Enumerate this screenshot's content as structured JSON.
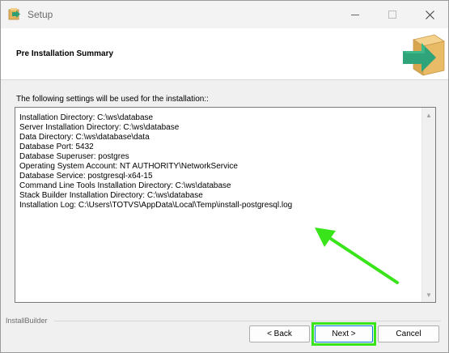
{
  "window": {
    "title": "Setup"
  },
  "header": {
    "title": "Pre Installation Summary"
  },
  "content": {
    "intro": "The following settings will be used for the installation::",
    "lines": [
      "Installation Directory: C:\\ws\\database",
      "Server Installation Directory: C:\\ws\\database",
      "Data Directory: C:\\ws\\database\\data",
      "Database Port: 5432",
      "Database Superuser: postgres",
      "Operating System Account: NT AUTHORITY\\NetworkService",
      "Database Service: postgresql-x64-15",
      "Command Line Tools Installation Directory: C:\\ws\\database",
      "Stack Builder Installation Directory: C:\\ws\\database",
      "Installation Log: C:\\Users\\TOTVS\\AppData\\Local\\Temp\\install-postgresql.log"
    ]
  },
  "footer": {
    "brand": "InstallBuilder",
    "back_label": "< Back",
    "next_label": "Next >",
    "cancel_label": "Cancel"
  },
  "icons": {
    "app": "setup-box-arrow-icon",
    "header_logo": "installer-box-arrow-icon",
    "minimize": "minimize-icon",
    "maximize": "maximize-icon",
    "close": "close-icon",
    "scroll_up": "scroll-up-arrow-icon",
    "scroll_down": "scroll-down-arrow-icon",
    "annotation": "green-annotation-arrow-icon"
  },
  "colors": {
    "annotation_green": "#39e51a",
    "box_tan": "#e6b560",
    "arrow_teal": "#2fa37a"
  }
}
